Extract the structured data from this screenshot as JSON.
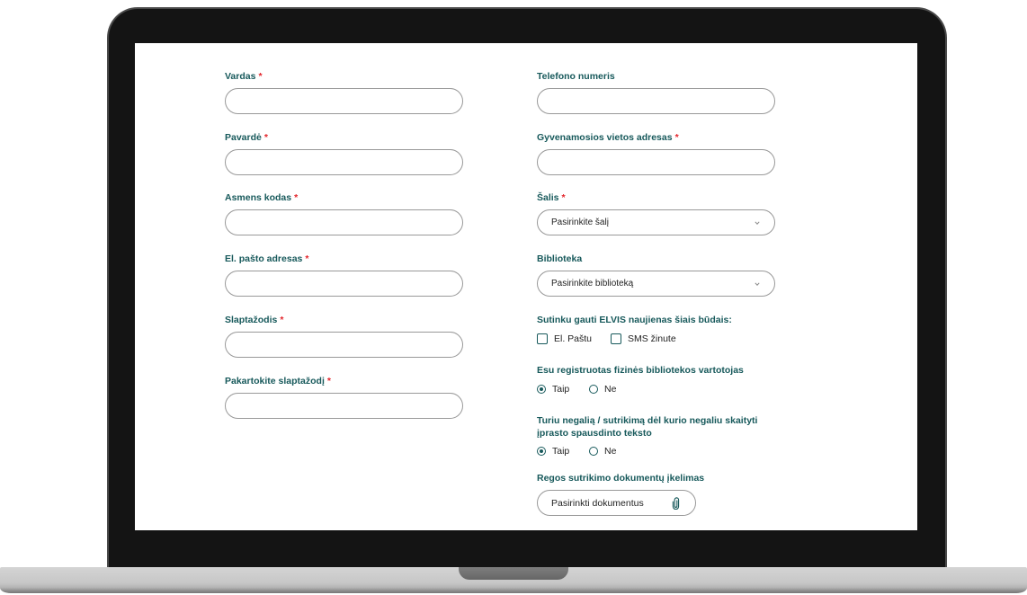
{
  "colors": {
    "accent": "#17595b",
    "required": "#e3262c",
    "field_border": "#999999",
    "text": "#222222"
  },
  "form": {
    "vardas": {
      "label": "Vardas",
      "required_mark": "*",
      "value": ""
    },
    "pavarde": {
      "label": "Pavardė",
      "required_mark": "*",
      "value": ""
    },
    "asmens_kodas": {
      "label": "Asmens kodas",
      "required_mark": "*",
      "value": ""
    },
    "el_pastas": {
      "label": "El. pašto adresas",
      "required_mark": "*",
      "value": ""
    },
    "slaptazodis": {
      "label": "Slaptažodis",
      "required_mark": "*",
      "value": ""
    },
    "pakartokite_slaptazodi": {
      "label": "Pakartokite slaptažodį",
      "required_mark": "*",
      "value": ""
    },
    "telefonas": {
      "label": "Telefono numeris",
      "value": ""
    },
    "adresas": {
      "label": "Gyvenamosios vietos adresas",
      "required_mark": "*",
      "value": ""
    },
    "salis": {
      "label": "Šalis",
      "required_mark": "*",
      "selected": "Pasirinkite šalį",
      "icon": "chevron-down-icon"
    },
    "biblioteka": {
      "label": "Biblioteka",
      "selected": "Pasirinkite biblioteką",
      "icon": "chevron-down-icon"
    },
    "naujienos": {
      "label": "Sutinku gauti ELVIS naujienas šiais būdais:",
      "options": [
        {
          "label": "El. Paštu",
          "checked": false
        },
        {
          "label": "SMS žinute",
          "checked": false
        }
      ]
    },
    "registruotas": {
      "label": "Esu registruotas fizinės bibliotekos vartotojas",
      "options": [
        {
          "label": "Taip",
          "selected": true
        },
        {
          "label": "Ne",
          "selected": false
        }
      ]
    },
    "negalia": {
      "label": "Turiu negalią / sutrikimą dėl kurio negaliu skaityti įprasto spausdinto teksto",
      "options": [
        {
          "label": "Taip",
          "selected": true
        },
        {
          "label": "Ne",
          "selected": false
        }
      ]
    },
    "dokumentai": {
      "label": "Regos sutrikimo dokumentų įkelimas",
      "button_label": "Pasirinkti dokumentus",
      "icon": "paperclip-icon"
    }
  }
}
